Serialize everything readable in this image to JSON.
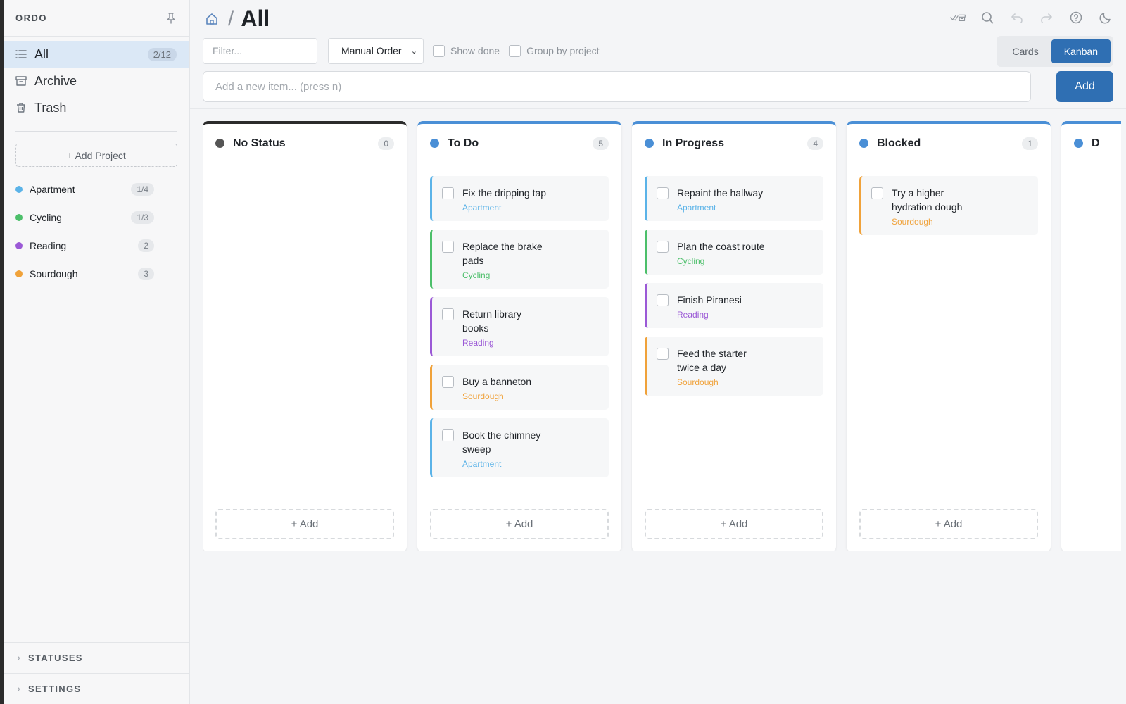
{
  "sidebar": {
    "brand": "ORDO",
    "nav": [
      {
        "label": "All",
        "count": "2/12"
      },
      {
        "label": "Archive"
      },
      {
        "label": "Trash"
      }
    ],
    "add_project": "+ Add Project",
    "projects": [
      {
        "name": "Apartment",
        "count": "1/4",
        "color": "#5bb3e8"
      },
      {
        "name": "Cycling",
        "count": "1/3",
        "color": "#4cbf6a"
      },
      {
        "name": "Reading",
        "count": "2",
        "color": "#9b59d6"
      },
      {
        "name": "Sourdough",
        "count": "3",
        "color": "#f0a23a"
      }
    ],
    "sections": [
      "STATUSES",
      "SETTINGS"
    ]
  },
  "header": {
    "breadcrumb_sep": "/",
    "title": "All"
  },
  "controls": {
    "filter_placeholder": "Filter...",
    "sort": "Manual Order",
    "show_done": "Show done",
    "group_by_project": "Group by project",
    "views": [
      "Cards",
      "Kanban"
    ],
    "active_view": "Kanban"
  },
  "new_item": {
    "placeholder": "Add a new item... (press n)",
    "add_label": "Add"
  },
  "board": {
    "columns": [
      {
        "name": "No Status",
        "count": "0",
        "dot": "#555555",
        "add": "+ Add",
        "cards": []
      },
      {
        "name": "To Do",
        "count": "5",
        "dot": "#4a8fd6",
        "add": "+ Add",
        "cards": [
          {
            "text": "Fix the dripping tap",
            "project": "Apartment",
            "color": "#5bb3e8"
          },
          {
            "text": "Replace the brake pads",
            "project": "Cycling",
            "color": "#4cbf6a"
          },
          {
            "text": "Return library books",
            "project": "Reading",
            "color": "#9b59d6"
          },
          {
            "text": "Buy a banneton",
            "project": "Sourdough",
            "color": "#f0a23a"
          },
          {
            "text": "Book the chimney sweep",
            "project": "Apartment",
            "color": "#5bb3e8"
          }
        ]
      },
      {
        "name": "In Progress",
        "count": "4",
        "dot": "#4a8fd6",
        "add": "+ Add",
        "cards": [
          {
            "text": "Repaint the hallway",
            "project": "Apartment",
            "color": "#5bb3e8"
          },
          {
            "text": "Plan the coast route",
            "project": "Cycling",
            "color": "#4cbf6a"
          },
          {
            "text": "Finish Piranesi",
            "project": "Reading",
            "color": "#9b59d6"
          },
          {
            "text": "Feed the starter twice a day",
            "project": "Sourdough",
            "color": "#f0a23a"
          }
        ]
      },
      {
        "name": "Blocked",
        "count": "1",
        "dot": "#4a8fd6",
        "add": "+ Add",
        "cards": [
          {
            "text": "Try a higher hydration dough",
            "project": "Sourdough",
            "color": "#f0a23a"
          }
        ]
      },
      {
        "name": "D",
        "count": "",
        "dot": "#4a8fd6",
        "add": "",
        "cards": []
      }
    ]
  }
}
